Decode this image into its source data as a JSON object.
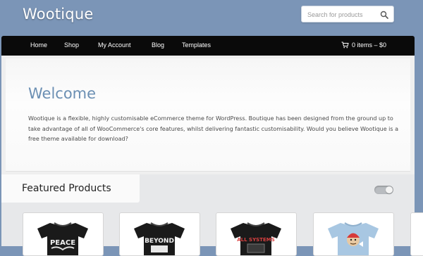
{
  "site": {
    "title": "Wootique"
  },
  "search": {
    "placeholder": "Search for products"
  },
  "nav": {
    "items": [
      {
        "label": "Home"
      },
      {
        "label": "Shop"
      },
      {
        "label": "My Account"
      },
      {
        "label": "Blog"
      },
      {
        "label": "Templates"
      }
    ],
    "cart": {
      "label": "0 items – $0"
    }
  },
  "welcome": {
    "title": "Welcome",
    "text": "Wootique is a flexible, highly customisable eCommerce theme for WordPress. Boutique has been designed from the ground up to take advantage of all of WooCommerce's core features, whilst delivering fantastic customisability. Would you believe Wootique is a free theme available for download?"
  },
  "featured": {
    "title": "Featured Products",
    "products": [
      {
        "shirt_text": "PEACE",
        "shirt_color": "#1a1a1a"
      },
      {
        "shirt_text": "BEYOND",
        "shirt_color": "#1a1a1a"
      },
      {
        "shirt_text": "ALL SYSTEMS",
        "shirt_color": "#1a1a1a"
      },
      {
        "shirt_text": "",
        "shirt_color": "#a8c7e2"
      }
    ]
  },
  "colors": {
    "background": "#7b95b7",
    "navbar": "#0a0a0a",
    "welcome_title": "#6b8fb3"
  },
  "icons": {
    "search": "search-icon",
    "cart": "cart-icon",
    "toggle": "toggle-switch"
  }
}
